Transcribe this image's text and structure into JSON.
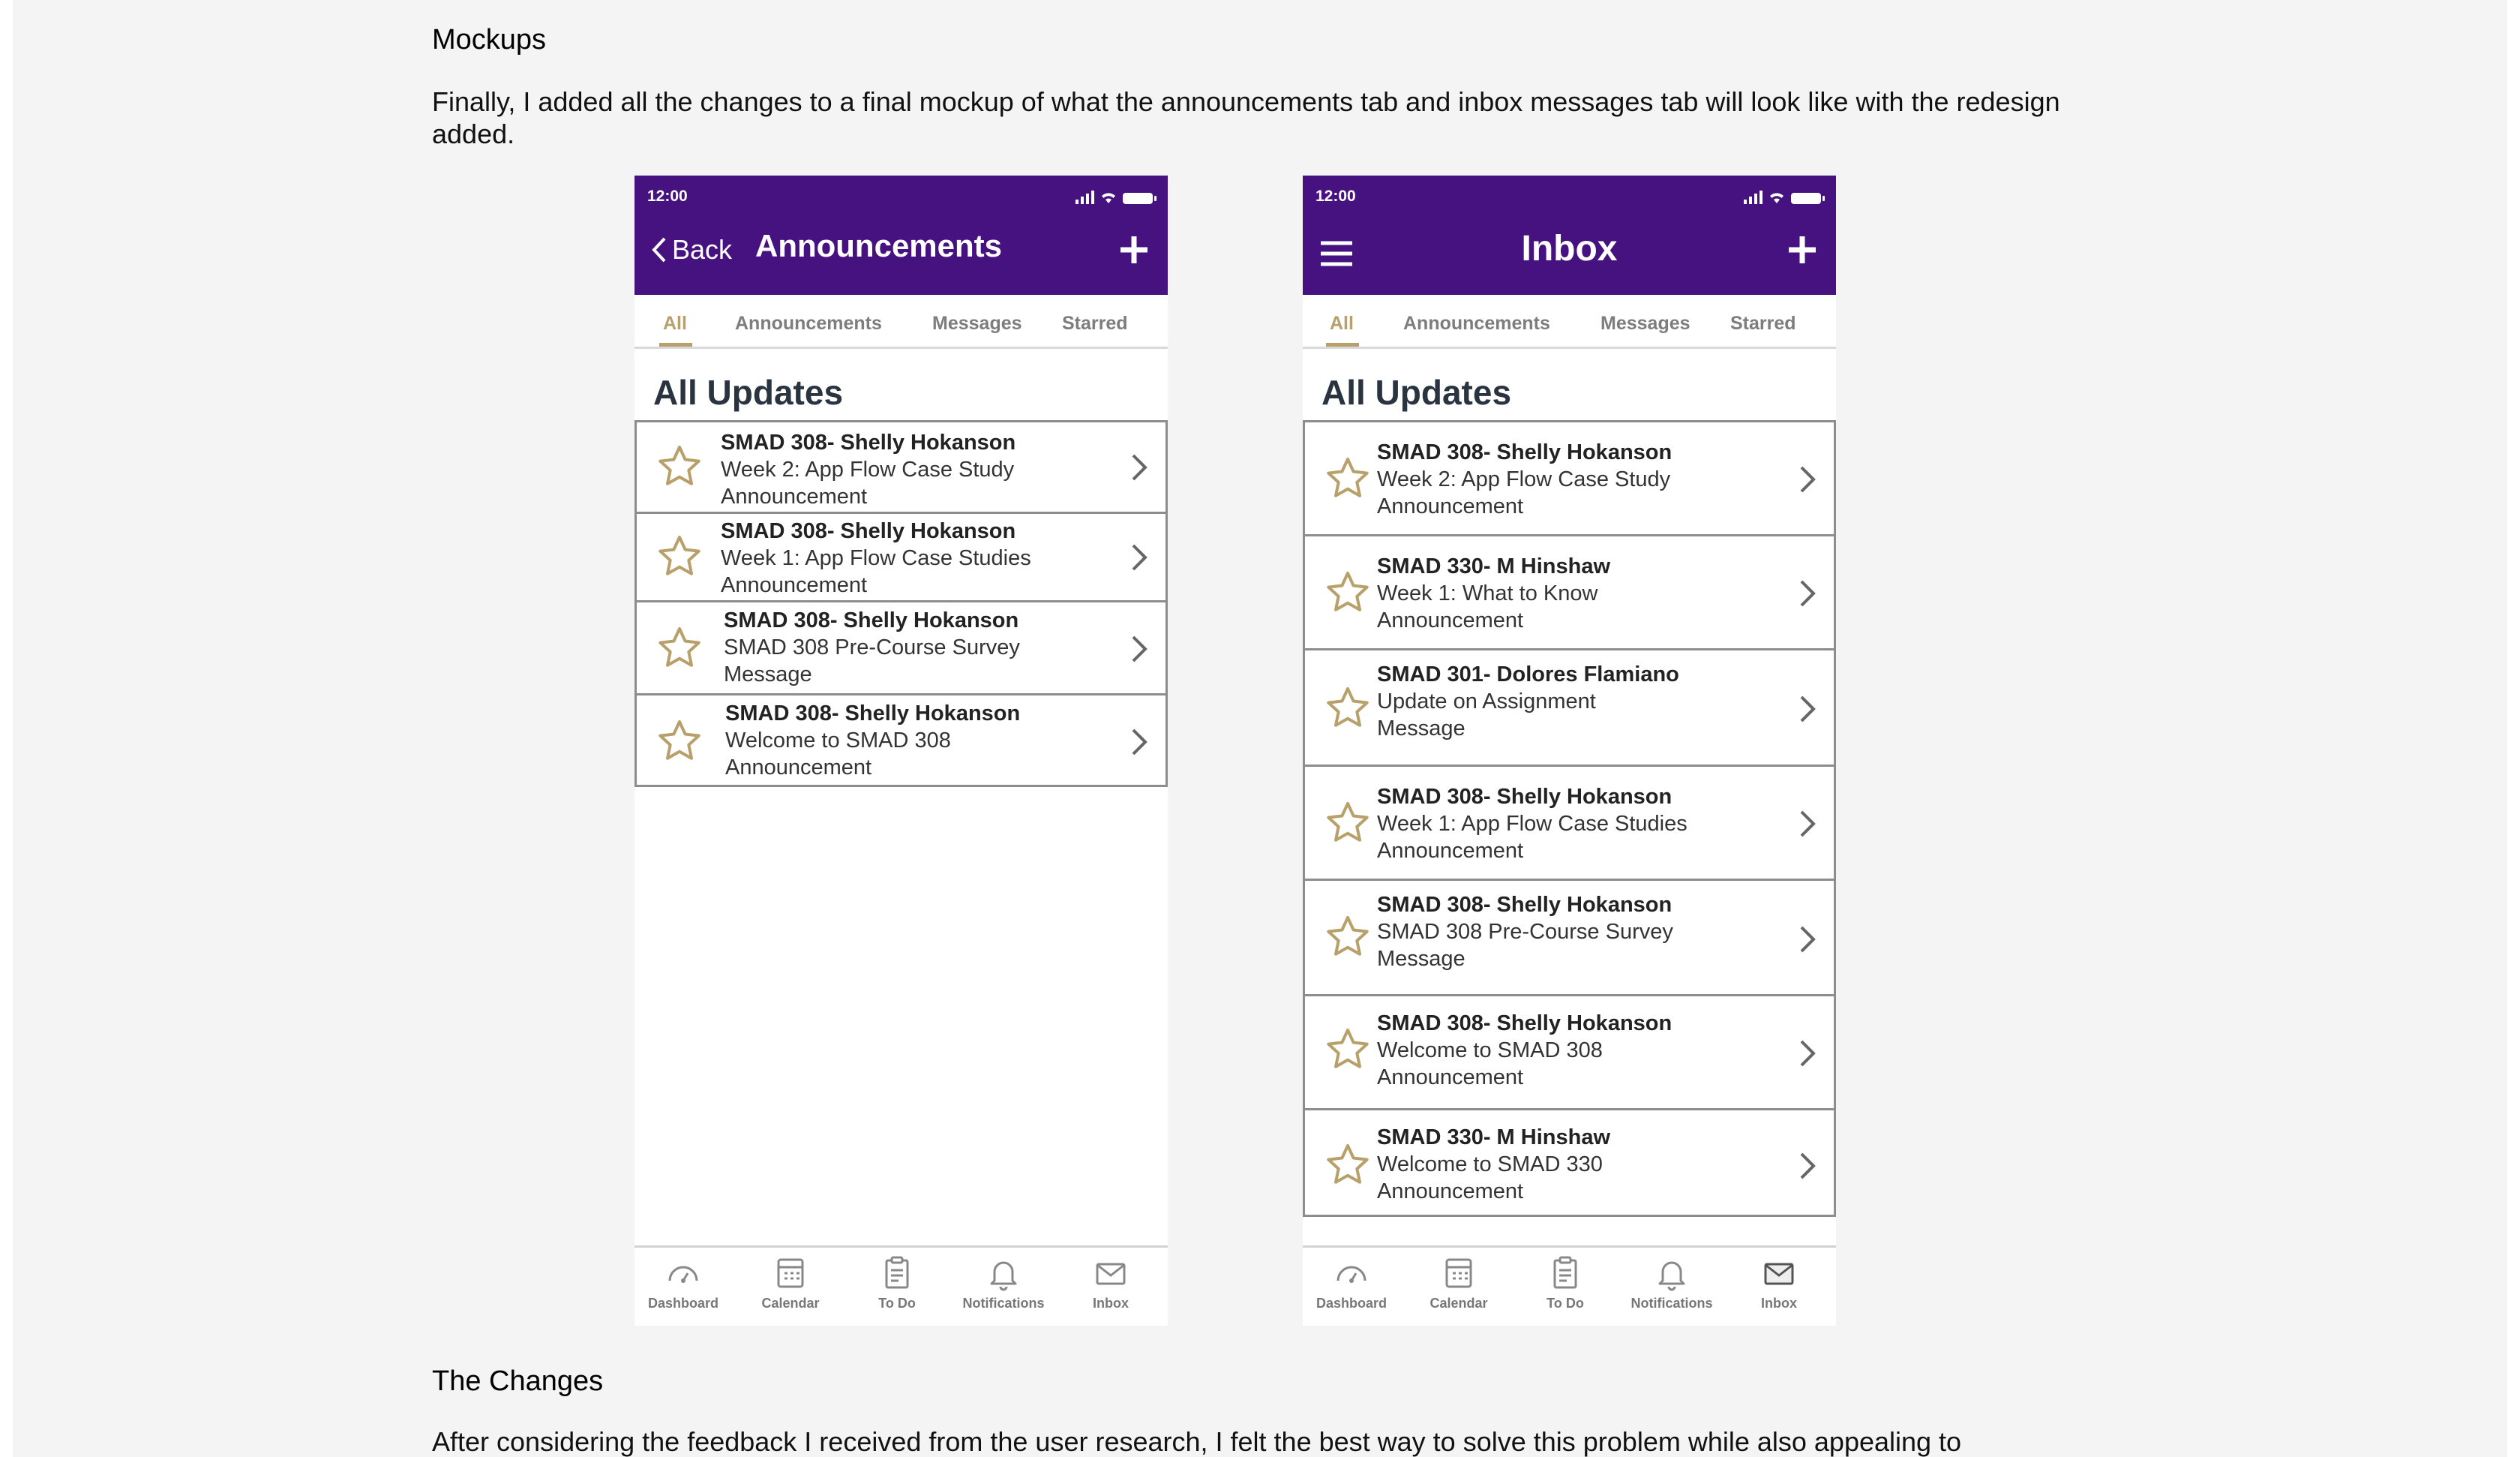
{
  "mockups_title": "Mockups",
  "mockups_body": "Finally, I added all the changes to a final mockup of what the announcements tab and inbox messages tab will look like with the redesign added.",
  "changes_title": "The Changes",
  "changes_body": "After considering the feedback I received from the user research, I felt the best way to solve this problem while also appealing to",
  "colors": {
    "header": "#461280",
    "accent_gold": "#b7a06a",
    "tab_inactive": "#7d7d7d"
  },
  "left_phone": {
    "time": "12:00",
    "back_label": "Back",
    "title": "Announcements",
    "tabs": [
      "All",
      "Announcements",
      "Messages",
      "Starred"
    ],
    "active_tab": "All",
    "section_title": "All Updates",
    "items": [
      {
        "course": "SMAD 308- Shelly Hokanson",
        "subject": "Week 2: App Flow Case Study",
        "type": "Announcement"
      },
      {
        "course": "SMAD 308- Shelly Hokanson",
        "subject": "Week 1: App Flow Case Studies",
        "type": "Announcement"
      },
      {
        "course": "SMAD 308- Shelly Hokanson",
        "subject": "SMAD 308 Pre-Course Survey",
        "type": "Message"
      },
      {
        "course": "SMAD 308- Shelly Hokanson",
        "subject": "Welcome to SMAD 308",
        "type": "Announcement"
      }
    ],
    "tabbar": [
      "Dashboard",
      "Calendar",
      "To Do",
      "Notifications",
      "Inbox"
    ]
  },
  "right_phone": {
    "time": "12:00",
    "title": "Inbox",
    "tabs": [
      "All",
      "Announcements",
      "Messages",
      "Starred"
    ],
    "active_tab": "All",
    "section_title": "All Updates",
    "items": [
      {
        "course": "SMAD 308- Shelly Hokanson",
        "subject": "Week 2: App Flow Case Study",
        "type": "Announcement"
      },
      {
        "course": "SMAD 330- M Hinshaw",
        "subject": "Week 1: What to Know",
        "type": "Announcement"
      },
      {
        "course": "SMAD 301- Dolores Flamiano",
        "subject": "Update on Assignment",
        "type": "Message"
      },
      {
        "course": "SMAD 308- Shelly Hokanson",
        "subject": "Week 1: App Flow Case Studies",
        "type": "Announcement"
      },
      {
        "course": "SMAD 308- Shelly Hokanson",
        "subject": "SMAD 308 Pre-Course Survey",
        "type": "Message"
      },
      {
        "course": "SMAD 308- Shelly Hokanson",
        "subject": "Welcome to SMAD 308",
        "type": "Announcement"
      },
      {
        "course": "SMAD 330- M Hinshaw",
        "subject": "Welcome to SMAD 330",
        "type": "Announcement"
      }
    ],
    "tabbar": [
      "Dashboard",
      "Calendar",
      "To Do",
      "Notifications",
      "Inbox"
    ]
  }
}
